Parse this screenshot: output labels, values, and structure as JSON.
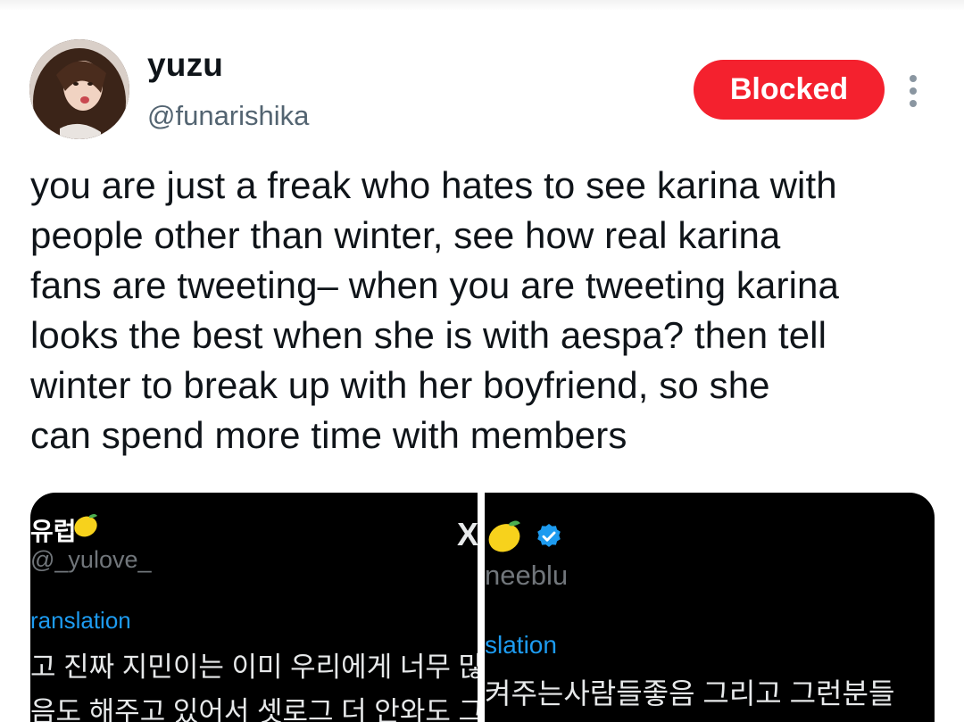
{
  "author": {
    "display_name": "yuzu",
    "handle": "@funarishika"
  },
  "actions": {
    "blocked_label": "Blocked"
  },
  "tweet": {
    "text": "you are just a freak who hates to see karina with\npeople other than winter, see how real karina\nfans are tweeting– when you are tweeting karina\nlooks the best when she is with aespa? then tell\nwinter to break up with her boyfriend, so she\ncan spend more time with members"
  },
  "media": {
    "left": {
      "name": "유럽",
      "handle": "@_yulove_",
      "translation_label": "ranslation",
      "line1": "고 진짜 지민이는 이미 우리에게 너무 많",
      "line2": "음도 해주고 있어서 셋로그 더 안와도 그동"
    },
    "right": {
      "handle": "neeblu",
      "translation_label": "slation",
      "line1": "켜주는사람들좋음 그리고 그런분들"
    }
  },
  "colors": {
    "blocked_bg": "#f4212e",
    "handle_gray": "#536471",
    "link_blue": "#1d9bf0",
    "media_bg": "#000000"
  },
  "icons": {
    "more": "vertical-ellipsis-icon",
    "lemon": "lemon-emoji-icon",
    "verified": "verified-badge-icon",
    "x_logo": "x-logo-icon"
  }
}
